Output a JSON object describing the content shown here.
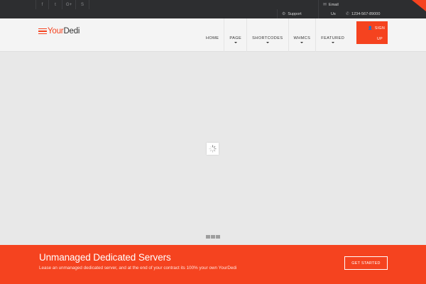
{
  "topbar": {
    "social": [
      {
        "icon": "facebook-icon",
        "glyph": "f"
      },
      {
        "icon": "twitter-icon",
        "glyph": "t"
      },
      {
        "icon": "google-plus-icon",
        "glyph": "G+"
      },
      {
        "icon": "skype-icon",
        "glyph": "S"
      }
    ],
    "support_label": "Support",
    "email_label": "Email",
    "email_label_2": "Us",
    "phone": "1234-567-89000"
  },
  "header": {
    "logo_part1": "Your",
    "logo_part2": "Dedi",
    "nav": [
      "HOME",
      "PAGE",
      "SHORTCODES",
      "WHMCS",
      "FEATURED"
    ],
    "signup_line1": "SIGN",
    "signup_line2": "UP"
  },
  "cta": {
    "title": "Unmanaged Dedicated Servers",
    "subtitle": "Lease an unmanaged dedicated server, and at the end of your contract its 100% your own YourDedi",
    "button_label": "GET STARTED"
  },
  "colors": {
    "accent": "#f5431f",
    "topbar": "#2d2e30",
    "header": "#f4f4f4"
  }
}
